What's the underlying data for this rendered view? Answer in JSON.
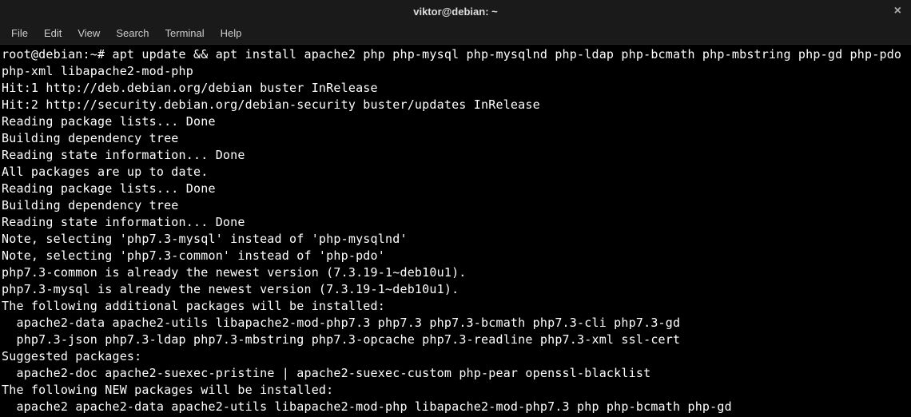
{
  "window": {
    "title": "viktor@debian: ~",
    "close_label": "×"
  },
  "menu": {
    "file": "File",
    "edit": "Edit",
    "view": "View",
    "search": "Search",
    "terminal": "Terminal",
    "help": "Help"
  },
  "terminal": {
    "prompt": "root@debian:~# ",
    "command": "apt update && apt install apache2 php php-mysql php-mysqlnd php-ldap php-bcmath php-mbstring php-gd php-pdo php-xml libapache2-mod-php",
    "output": "Hit:1 http://deb.debian.org/debian buster InRelease\nHit:2 http://security.debian.org/debian-security buster/updates InRelease\nReading package lists... Done\nBuilding dependency tree\nReading state information... Done\nAll packages are up to date.\nReading package lists... Done\nBuilding dependency tree\nReading state information... Done\nNote, selecting 'php7.3-mysql' instead of 'php-mysqlnd'\nNote, selecting 'php7.3-common' instead of 'php-pdo'\nphp7.3-common is already the newest version (7.3.19-1~deb10u1).\nphp7.3-mysql is already the newest version (7.3.19-1~deb10u1).\nThe following additional packages will be installed:\n  apache2-data apache2-utils libapache2-mod-php7.3 php7.3 php7.3-bcmath php7.3-cli php7.3-gd\n  php7.3-json php7.3-ldap php7.3-mbstring php7.3-opcache php7.3-readline php7.3-xml ssl-cert\nSuggested packages:\n  apache2-doc apache2-suexec-pristine | apache2-suexec-custom php-pear openssl-blacklist\nThe following NEW packages will be installed:\n  apache2 apache2-data apache2-utils libapache2-mod-php libapache2-mod-php7.3 php php-bcmath php-gd"
  }
}
